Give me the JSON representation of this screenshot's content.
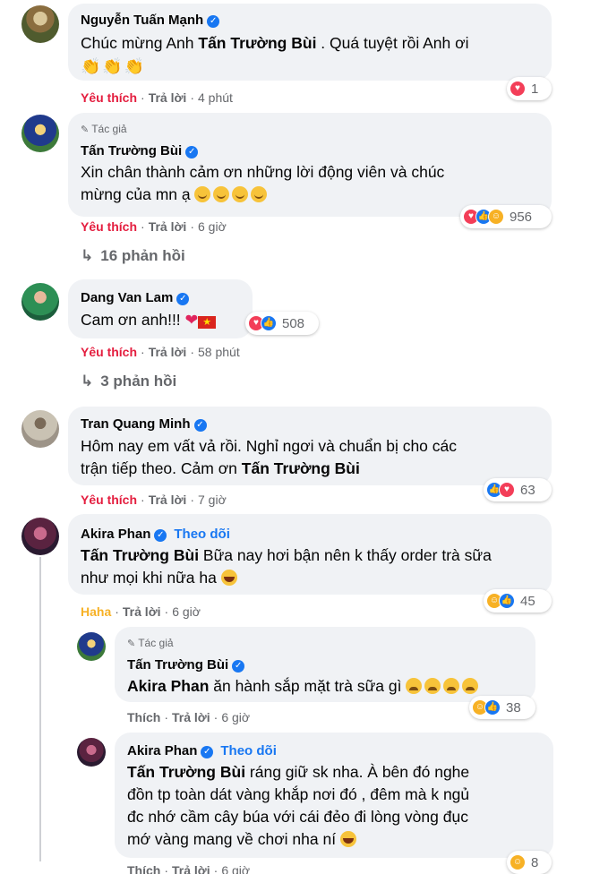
{
  "comments": [
    {
      "name": "Nguyễn Tuấn Mạnh",
      "text_prefix": "Chúc mừng Anh ",
      "mention": "Tấn Trường Bùi",
      "text_suffix": " . Quá tuyệt rồi Anh ơi",
      "emoji_line": "👏👏👏",
      "action_react": "Yêu thích",
      "action_reply": "Trả lời",
      "time": "4 phút",
      "reaction_count": "1",
      "reaction_icons": [
        "heart-icon"
      ]
    },
    {
      "author_tag": "Tác giả",
      "name": "Tấn Trường Bùi",
      "text_line1": "Xin chân thành cảm ơn những lời động viên và chúc",
      "text_line2": "mừng của mn ạ",
      "action_react": "Yêu thích",
      "action_reply": "Trả lời",
      "time": "6 giờ",
      "reaction_count": "956",
      "reaction_icons": [
        "heart-icon",
        "like-icon",
        "care-icon"
      ],
      "replies": "16 phản hồi"
    },
    {
      "name": "Dang Van Lam",
      "text": "Cam ơn anh!!!",
      "emoji_line": "❤️ 🇻🇳",
      "action_react": "Yêu thích",
      "action_reply": "Trả lời",
      "time": "58 phút",
      "reaction_count": "508",
      "reaction_icons": [
        "heart-icon",
        "like-icon"
      ],
      "replies": "3 phản hồi"
    },
    {
      "name": "Tran Quang Minh",
      "text_line1": "Hôm nay em vất vả rồi. Nghỉ ngơi và chuẩn bị cho các",
      "text_line2_prefix": "trận tiếp theo. Cảm ơn ",
      "mention": "Tấn Trường Bùi",
      "action_react": "Yêu thích",
      "action_reply": "Trả lời",
      "time": "7 giờ",
      "reaction_count": "63",
      "reaction_icons": [
        "like-icon",
        "heart-icon"
      ]
    },
    {
      "name": "Akira Phan",
      "follow": "Theo dõi",
      "mention": "Tấn Trường Bùi",
      "text_line1": " Bữa nay hơi bận nên k thấy order trà sữa",
      "text_line2": "như mọi khi nữa ha",
      "action_react": "Haha",
      "action_reply": "Trả lời",
      "time": "6 giờ",
      "reaction_count": "45",
      "reaction_icons": [
        "haha-icon",
        "like-icon"
      ]
    },
    {
      "author_tag": "Tác giả",
      "name": "Tấn Trường Bùi",
      "mention": "Akira Phan",
      "text": " ăn hành sắp mặt trà sữa gì",
      "action_react": "Thích",
      "action_reply": "Trả lời",
      "time": "6 giờ",
      "reaction_count": "38",
      "reaction_icons": [
        "haha-icon",
        "like-icon"
      ]
    },
    {
      "name": "Akira Phan",
      "follow": "Theo dõi",
      "mention": "Tấn Trường Bùi",
      "text_line1": " ráng giữ sk nha. À bên đó nghe",
      "text_line2": "đồn tp toàn dát vàng khắp nơi đó , đêm mà k ngủ",
      "text_line3": "đc nhớ cầm cây búa với cái đẻo đi lòng vòng đục",
      "text_line4": "mớ vàng mang về chơi nha ní",
      "action_react": "Thích",
      "action_reply": "Trả lời",
      "time": "6 giờ",
      "reaction_count": "8",
      "reaction_icons": [
        "haha-icon"
      ]
    }
  ],
  "colors": {
    "bubble": "#f0f2f5",
    "verified": "#1877f2",
    "liked": "#e41e3f",
    "haha": "#f7b125",
    "meta": "#65676b"
  }
}
